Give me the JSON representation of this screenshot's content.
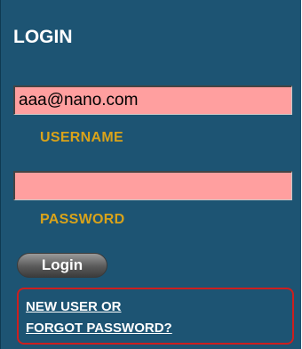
{
  "login": {
    "title": "LOGIN",
    "username_value": "aaa@nano.com",
    "username_label": "USERNAME",
    "password_value": "",
    "password_label": "PASSWORD",
    "button_label": "Login",
    "link_line1": "NEW USER OR",
    "link_line2": "FORGOT PASSWORD?"
  },
  "colors": {
    "panel_background": "#1d5473",
    "field_background": "#ff9f9f",
    "label_color": "#d9a31a",
    "highlight_border": "#cc1f1f"
  }
}
